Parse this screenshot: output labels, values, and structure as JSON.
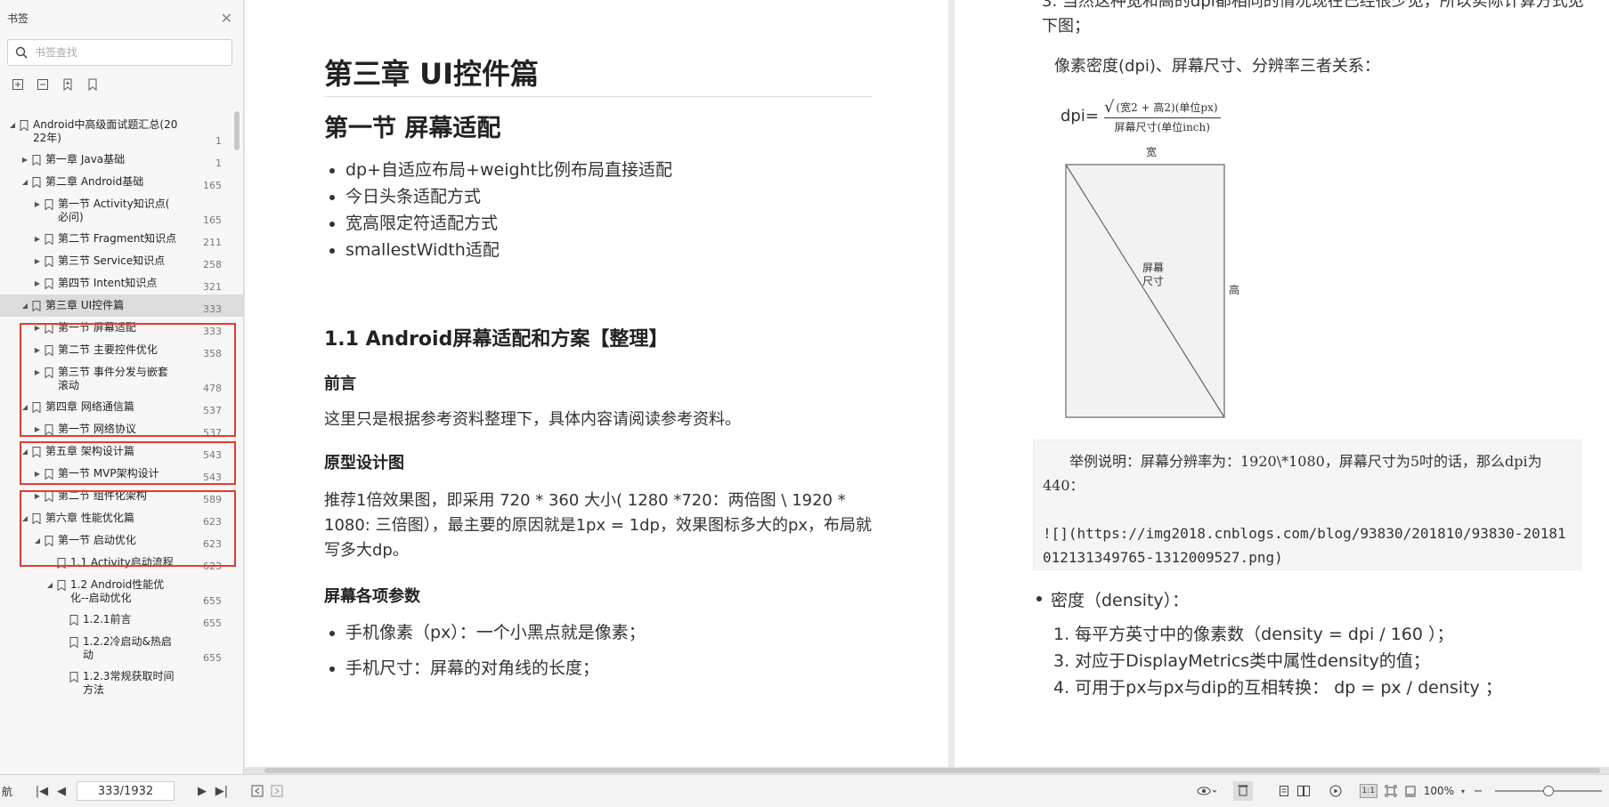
{
  "sidebar": {
    "title": "书签",
    "search_placeholder": "书签查找",
    "tools": [
      "expand-all-icon",
      "collapse-all-icon",
      "bookmark-add-icon",
      "bookmark-icon"
    ],
    "items": [
      {
        "label": "Android中高级面试题汇总(20\n22年)",
        "page": "1",
        "level": 0,
        "open": true
      },
      {
        "label": "第一章 Java基础",
        "page": "1",
        "level": 1,
        "open": false
      },
      {
        "label": "第二章 Android基础",
        "page": "165",
        "level": 1,
        "open": true
      },
      {
        "label": "第一节 Activity知识点(\n必问)",
        "page": "165",
        "level": 2,
        "open": false
      },
      {
        "label": "第二节 Fragment知识点",
        "page": "211",
        "level": 2,
        "open": false
      },
      {
        "label": "第三节 Service知识点",
        "page": "258",
        "level": 2,
        "open": false
      },
      {
        "label": "第四节 Intent知识点",
        "page": "321",
        "level": 2,
        "open": false
      },
      {
        "label": "第三章 UI控件篇",
        "page": "333",
        "level": 1,
        "open": true,
        "selected": true
      },
      {
        "label": "第一节 屏幕适配",
        "page": "333",
        "level": 2,
        "open": false
      },
      {
        "label": "第二节 主要控件优化",
        "page": "358",
        "level": 2,
        "open": false
      },
      {
        "label": "第三节 事件分发与嵌套\n滚动",
        "page": "478",
        "level": 2,
        "open": false
      },
      {
        "label": "第四章 网络通信篇",
        "page": "537",
        "level": 1,
        "open": true
      },
      {
        "label": "第一节 网络协议",
        "page": "537",
        "level": 2,
        "open": false
      },
      {
        "label": "第五章 架构设计篇",
        "page": "543",
        "level": 1,
        "open": true
      },
      {
        "label": "第一节 MVP架构设计",
        "page": "543",
        "level": 2,
        "open": false
      },
      {
        "label": "第二节 组件化架构",
        "page": "589",
        "level": 2,
        "open": false
      },
      {
        "label": "第六章 性能优化篇",
        "page": "623",
        "level": 1,
        "open": true
      },
      {
        "label": "第一节 启动优化",
        "page": "623",
        "level": 2,
        "open": true
      },
      {
        "label": "1.1 Activity启动流程",
        "page": "623",
        "level": 3,
        "leaf": true
      },
      {
        "label": "1.2 Android性能优\n化--启动优化",
        "page": "655",
        "level": 3,
        "open": true
      },
      {
        "label": "1.2.1前言",
        "page": "655",
        "level": 4,
        "leaf": true
      },
      {
        "label": "1.2.2冷启动&热启\n动",
        "page": "655",
        "level": 4,
        "leaf": true
      },
      {
        "label": "1.2.3常规获取时间\n方法",
        "page": "",
        "level": 4,
        "leaf": true
      }
    ]
  },
  "left_page": {
    "chapter_title": "第三章 UI控件篇",
    "section_title": "第一节 屏幕适配",
    "bullets": [
      "dp+自适应布局+weight比例布局直接适配",
      "今日头条适配方式",
      "宽高限定符适配方式",
      "smallestWidth适配"
    ],
    "subsection_title": "1.1 Android屏幕适配和方案【整理】",
    "preface_heading": "前言",
    "preface_text": "这里只是根据参考资料整理下，具体内容请阅读参考资料。",
    "prototype_heading": "原型设计图",
    "prototype_text": "推荐1倍效果图，即采用 720 * 360 大小( 1280 *720：两倍图 \\ 1920 * 1080: 三倍图），最主要的原因就是1px = 1dp，效果图标多大的px，布局就写多大dp。",
    "params_heading": "屏幕各项参数",
    "params_bullets": [
      "手机像素（px）：一个小黑点就是像素；",
      "手机尺寸：屏幕的对角线的长度；"
    ]
  },
  "right_page": {
    "top_text": "3. 当然这种宽和高的dpi都相同的情况现在已经很少见，所以实际计算方式见下图；",
    "relation_text": "像素密度(dpi)、屏幕尺寸、分辨率三者关系：",
    "formula_prefix": "dpi=",
    "formula_numerator": "(宽2 + 高2)(单位px)",
    "formula_denominator": "屏幕尺寸(单位inch)",
    "diagram_width_label": "宽",
    "diagram_height_label": "高",
    "diagram_center_label_1": "屏幕",
    "diagram_center_label_2": "尺寸",
    "code_line_1": "举例说明：屏幕分辨率为：1920\\*1080，屏幕尺寸为5吋的话，那么dpi为440：",
    "code_line_2": "![](https://img2018.cnblogs.com/blog/93830/201810/93830-20181012131349765-1312009527.png)",
    "density_bullet": "密度（density）：",
    "density_items": [
      "1. 每平方英寸中的像素数（density = dpi / 160 ）；",
      "3. 对应于DisplayMetrics类中属性density的值；",
      "4. 可用于px与px与dip的互相转换： dp = px / density ；"
    ]
  },
  "statusbar": {
    "left_fragment": "航",
    "page_value": "333/1932",
    "zoom": "100%",
    "zoom_level_fraction": 0.5,
    "actual_size_label": "1:1"
  },
  "colors": {
    "highlight_border": "#e53935",
    "selected_row": "#dcdcdc",
    "sidebar_bg": "#f7f7f7"
  }
}
